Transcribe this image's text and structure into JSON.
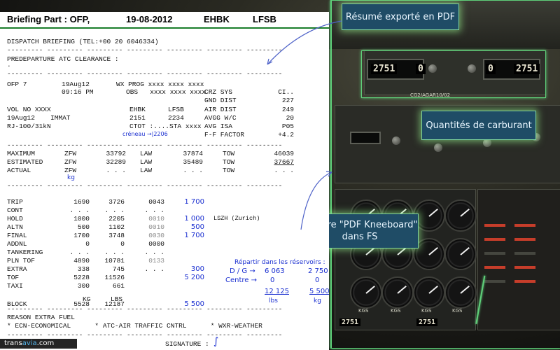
{
  "callouts": {
    "pdf_summary": "Résumé exporté en PDF",
    "fuel_quantities": "Quantités de carburant",
    "kneeboard_line1": "Fenêtre \"PDF Kneeboard\"",
    "kneeboard_line2": "dans FS"
  },
  "header": {
    "title": "Briefing Part : OFP,",
    "date": "19-08-2012",
    "origin": "EHBK",
    "destination": "LFSB"
  },
  "dispatch": {
    "line": "DISPATCH BRIEFING (TEL:+00 20 6046334)",
    "dashes": "--------- --------- --------- --------- --------- --------- ---------",
    "clearance": "PREDEPARTURE ATC CLEARANCE :",
    "dot": "."
  },
  "ofp": {
    "ofp_no": "OFP 7",
    "date1": "19Aug12",
    "wx": "WX PROG xxxx xxxx xxxx",
    "time": "09:16 PM",
    "obs": "OBS   xxxx xxxx xxxx",
    "crz": "CRZ SYS",
    "crz_val": "CI..",
    "gnd": "GND DIST",
    "gnd_val": "227",
    "vol": "VOL NO XXXX",
    "from": "EHBK",
    "to": "LFSB",
    "air": "AIR DIST",
    "air_val": "249",
    "date2": "19Aug12",
    "immat": "IMMAT",
    "t1": "2151",
    "t2": "2234",
    "avgg": "AVGG W/C",
    "avgg_val": "20",
    "ac": "RJ-100/31kN",
    "ctot": "CTOT :....STA xxxx",
    "avgisa": "AVG ISA",
    "avgisa_val": "P05",
    "creneau": "créneau →|2206",
    "ff": "F-F FACTOR",
    "ff_val": "+4.2"
  },
  "weights": {
    "rows": [
      {
        "label": "MAXIMUM",
        "zfw": "ZFW",
        "zfw_v": "33792",
        "law": "LAW",
        "law_v": "37874",
        "tow": "TOW",
        "tow_v": "46039"
      },
      {
        "label": "ESTIMATED",
        "zfw": "ZFW",
        "zfw_v": "32289",
        "law": "LAW",
        "law_v": "35489",
        "tow": "TOW",
        "tow_v": "37667"
      },
      {
        "label": "ACTUAL",
        "zfw": "ZFW",
        "zfw_v": ". . .",
        "law": "LAW",
        "law_v": ". . .",
        "tow": "TOW",
        "tow_v": ". . ."
      }
    ],
    "kg_note": "kg"
  },
  "fuel": {
    "rows": [
      {
        "label": "TRIP",
        "a": "1690",
        "b": "3726",
        "c": "0043",
        "hand": "1 700"
      },
      {
        "label": "CONT",
        "a": ". . .",
        "b": ". . .",
        "c": ". . .",
        "hand": ""
      },
      {
        "label": "HOLD",
        "a": "1000",
        "b": "2205",
        "c": "0010",
        "hand": "1 000"
      },
      {
        "label": "ALTN",
        "a": "500",
        "b": "1102",
        "c": "0010",
        "hand": "500"
      },
      {
        "label": "FINAL",
        "a": "1700",
        "b": "3748",
        "c": "0030",
        "hand": "1 700"
      },
      {
        "label": "ADDNL",
        "a": "0",
        "b": "0",
        "c": "0000",
        "hand": ""
      },
      {
        "label": "TANKERING",
        "a": ". . .",
        "b": ". . .",
        "c": ". . .",
        "hand": ""
      },
      {
        "label": "PLN TOF",
        "a": "4890",
        "b": "10781",
        "c": "0133",
        "hand": ""
      },
      {
        "label": "EXTRA",
        "a": "338",
        "b": "745",
        "c": ". . .",
        "hand": "300"
      },
      {
        "label": "TOF",
        "a": "5228",
        "b": "11526",
        "c": "",
        "hand": "5 200"
      },
      {
        "label": "TAXI",
        "a": "300",
        "b": "661",
        "c": "",
        "hand": ""
      },
      {
        "label": "BLOCK",
        "a": "5528",
        "b": "12187",
        "c": "",
        "hand": "5 500"
      }
    ],
    "units_kg": "KG",
    "units_lbs": "LBS",
    "altn_dest": "LSZH (Zurich)"
  },
  "tanks": {
    "title": "Répartir dans les réservoirs :",
    "dg_label": "D / G →",
    "dg_lbs": "6 063",
    "dg_kg": "2 750",
    "centre_label": "Centre →",
    "centre_lbs": "0",
    "centre_kg": "0",
    "total_lbs": "12 125",
    "total_kg": "5 500",
    "unit_lbs": "lbs",
    "unit_kg": "kg"
  },
  "reason": {
    "title": "REASON EXTRA FUEL",
    "items": "* ECN-ECONOMICAL      * ATC-AIR TRAFFIC CNTRL      * WXR-WEATHER",
    "signature": "SIGNATURE :"
  },
  "cockpit": {
    "fuel_left_a": "2751",
    "fuel_left_b": "0",
    "fuel_right_a": "0",
    "fuel_right_b": "2751",
    "panel_label": "CG2/AGAR10/02",
    "bottom_a": "2751",
    "bottom_b": "2751",
    "gauge_kgs": "KGS"
  },
  "logo": {
    "brand_a": "trans",
    "brand_b": "avia",
    "suffix": ".com"
  },
  "colors": {
    "callout_bg": "#1f4c66",
    "glow": "#7fd39b",
    "hand_ink": "#1a2fd0",
    "rule_green": "#1a7d2a"
  }
}
